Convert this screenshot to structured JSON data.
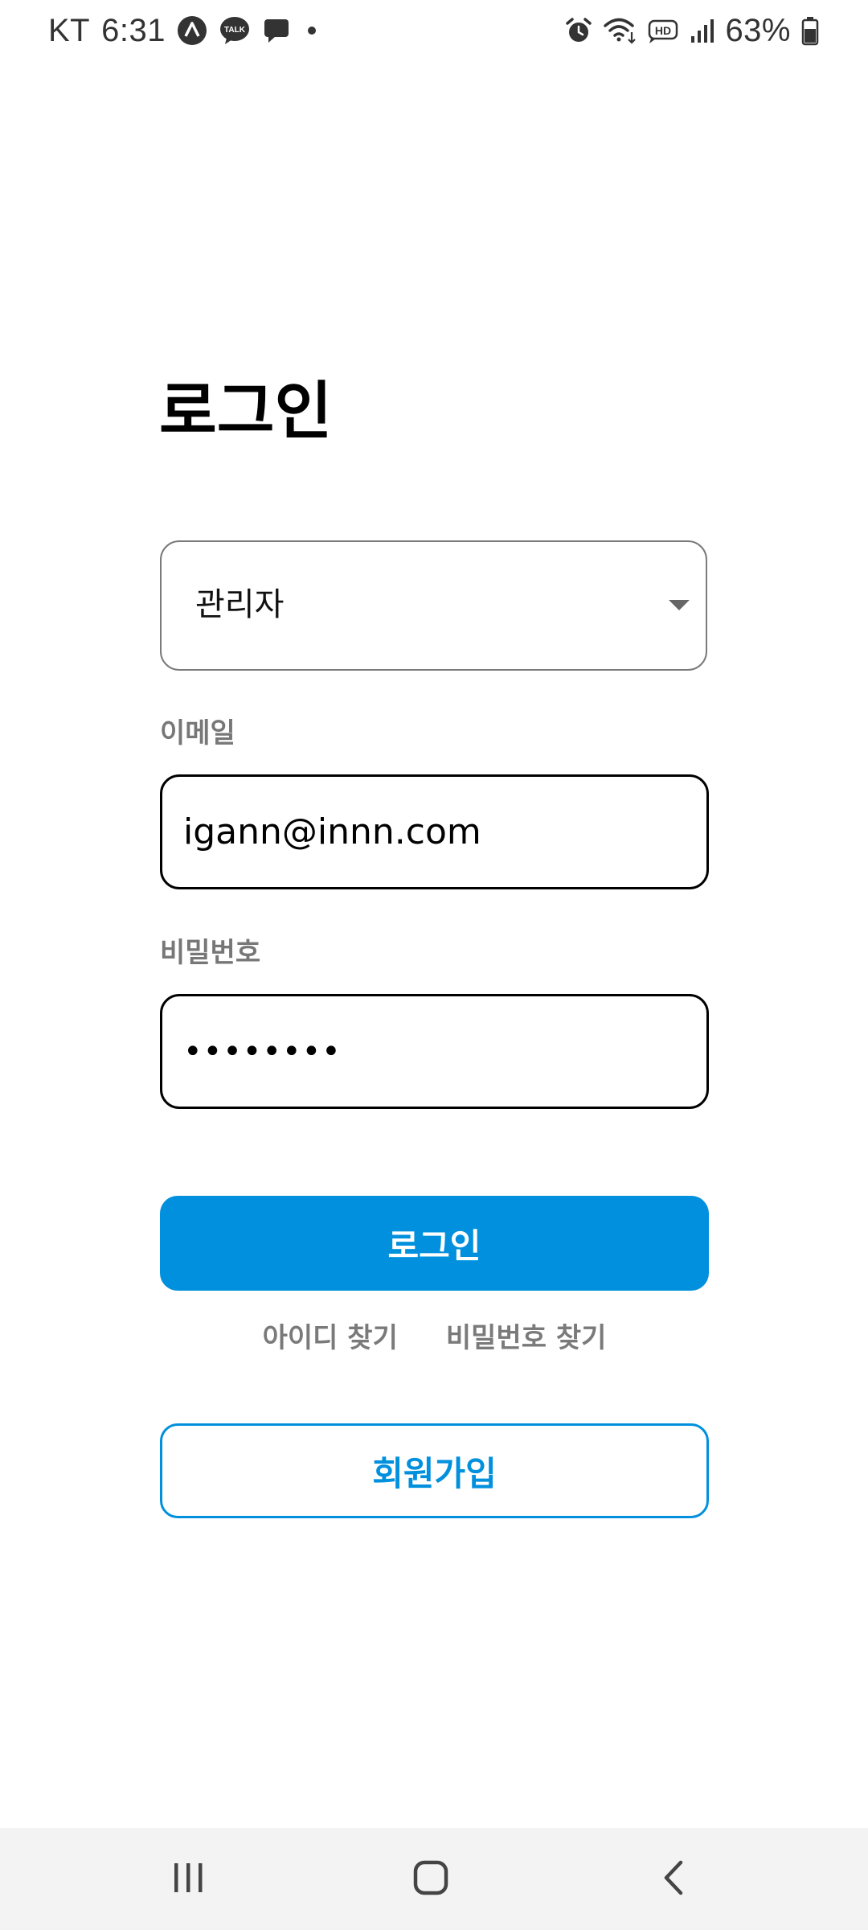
{
  "status_bar": {
    "carrier": "KT",
    "time": "6:31",
    "left_icons": [
      "navigation-app-icon",
      "kakaotalk-icon",
      "chat-bubble-icon",
      "notification-dot-icon"
    ],
    "talk_badge_text": "TALK",
    "right_icons": [
      "alarm-icon",
      "wifi-icon",
      "hd-voice-icon",
      "signal-icon",
      "battery-icon"
    ],
    "hd_text": "HD",
    "battery_percent": "63%"
  },
  "login": {
    "title": "로그인",
    "role_select": {
      "selected": "관리자",
      "icon": "dropdown-caret-icon"
    },
    "email": {
      "label": "이메일",
      "value": "igann@innn.com"
    },
    "password": {
      "label": "비밀번호",
      "value": "••••••••"
    },
    "login_button": "로그인",
    "find_id_link": "아이디 찾기",
    "find_password_link": "비밀번호 찾기",
    "signup_button": "회원가입"
  },
  "nav_bar": {
    "buttons": [
      "recent-apps-icon",
      "home-icon",
      "back-icon"
    ]
  },
  "colors": {
    "accent": "#0190dd",
    "label_gray": "#777777",
    "nav_bg": "#f3f3f3"
  }
}
